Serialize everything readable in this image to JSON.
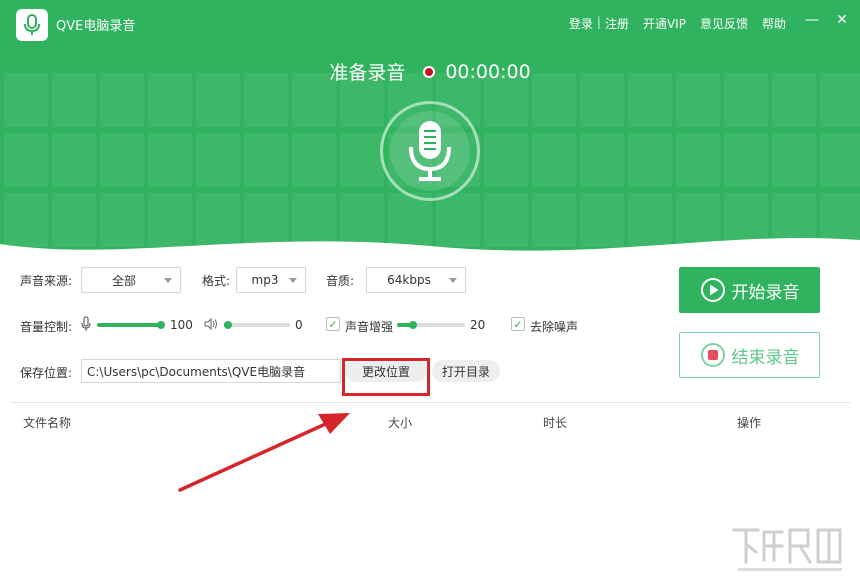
{
  "app": {
    "title": "QVE电脑录音"
  },
  "topnav": {
    "login": "登录",
    "separator": "|",
    "register": "注册",
    "vip": "开通VIP",
    "feedback": "意见反馈",
    "help": "帮助"
  },
  "window": {
    "minimize": "—",
    "close": "✕"
  },
  "status": {
    "label": "准备录音",
    "time": "00:00:00"
  },
  "settings": {
    "source_label": "声音来源:",
    "source_value": "全部",
    "format_label": "格式:",
    "format_value": "mp3",
    "quality_label": "音质:",
    "quality_value": "64kbps",
    "volume_label": "音量控制:",
    "mic_volume": "100",
    "speaker_volume": "0",
    "boost_label": "声音增强",
    "boost_value": "20",
    "denoise_label": "去除噪声",
    "save_label": "保存位置:",
    "save_path": "C:\\Users\\pc\\Documents\\QVE电脑录音",
    "change_location": "更改位置",
    "open_folder": "打开目录"
  },
  "actions": {
    "start": "开始录音",
    "stop": "结束录音"
  },
  "table": {
    "col_name": "文件名称",
    "col_size": "大小",
    "col_duration": "时长",
    "col_ops": "操作"
  },
  "colors": {
    "brand_green": "#2fb35e",
    "record_red": "#c8102e",
    "highlight_red": "#d7262b"
  }
}
